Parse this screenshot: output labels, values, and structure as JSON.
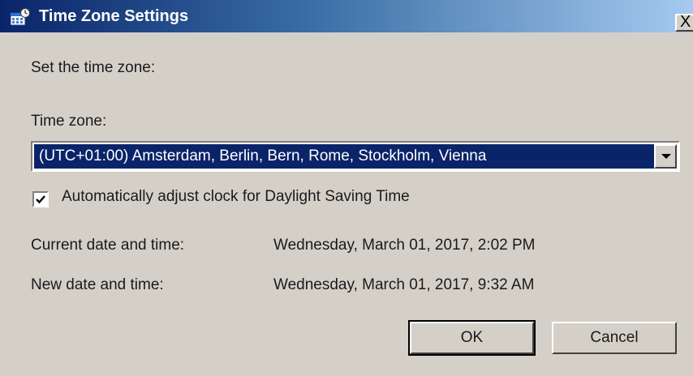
{
  "window": {
    "title": "Time Zone Settings",
    "title_icon": "clock-calendar-icon",
    "close_label": "X"
  },
  "prompt": "Set the time zone:",
  "timezone": {
    "label": "Time zone:",
    "selected": "(UTC+01:00) Amsterdam, Berlin, Bern, Rome, Stockholm, Vienna",
    "arrow_icon": "chevron-down-icon"
  },
  "dst": {
    "label": "Automatically adjust clock for Daylight Saving Time",
    "checked": true
  },
  "current": {
    "label": "Current date and time:",
    "value": "Wednesday, March 01, 2017, 2:02 PM"
  },
  "new": {
    "label": "New date and time:",
    "value": "Wednesday, March 01, 2017, 9:32 AM"
  },
  "buttons": {
    "ok": "OK",
    "cancel": "Cancel"
  },
  "colors": {
    "titlebar": "#0a246a",
    "selection": "#0a246a",
    "dialog_bg": "#d4d0c8"
  }
}
